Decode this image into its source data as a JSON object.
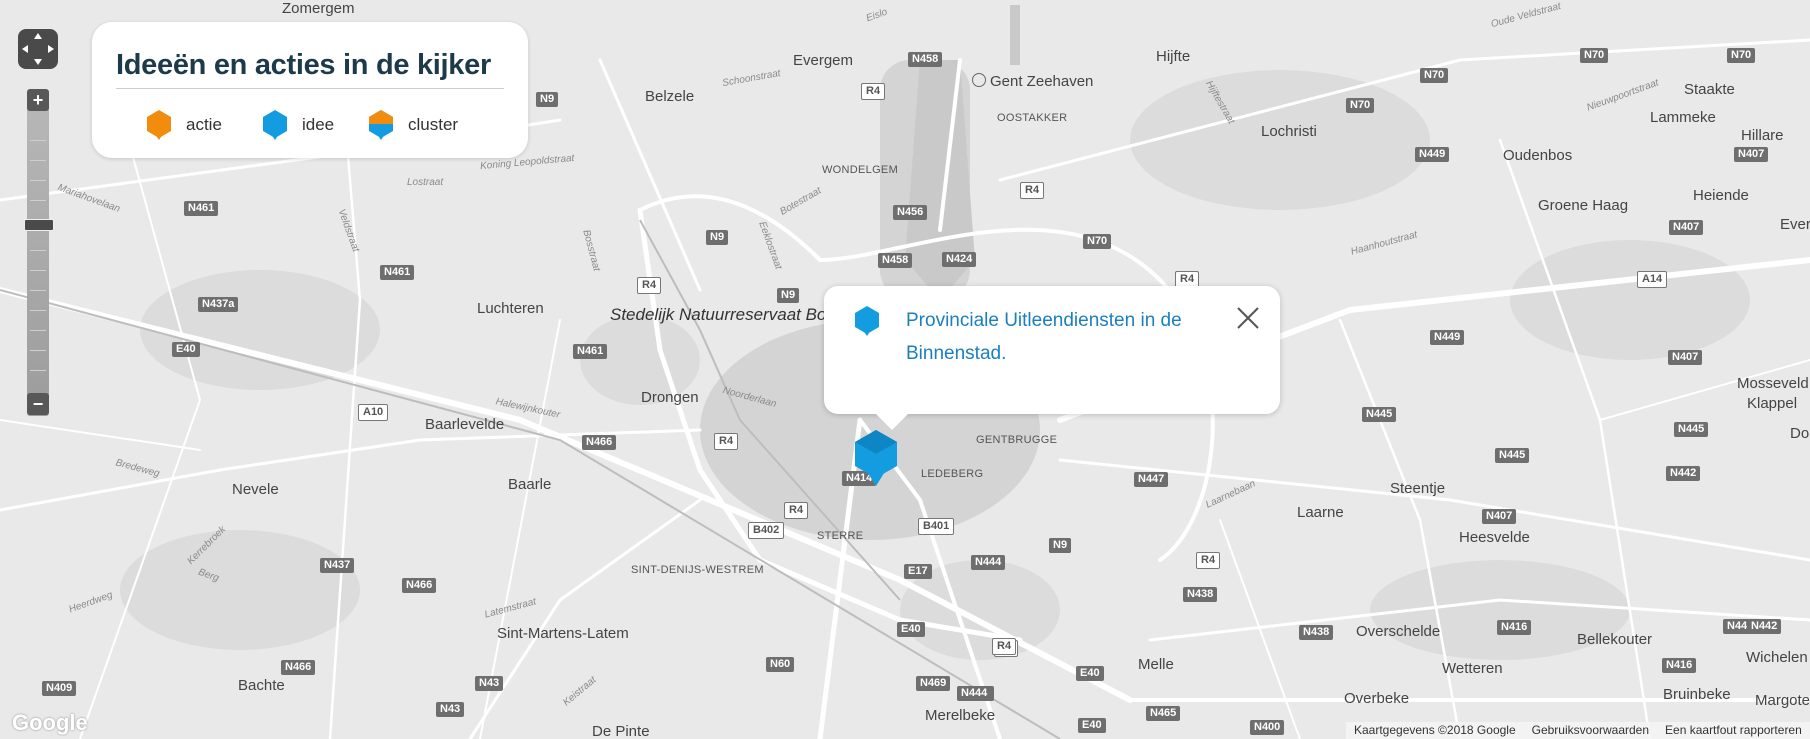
{
  "legend": {
    "title": "Ideeën en acties in de kijker",
    "items": [
      {
        "label": "actie",
        "icon": "hexagon-orange-icon",
        "color": "#f28c0f"
      },
      {
        "label": "idee",
        "icon": "hexagon-blue-icon",
        "color": "#139de0"
      },
      {
        "label": "cluster",
        "icon": "hexagon-split-icon",
        "color_top": "#f28c0f",
        "color_bottom": "#139de0"
      }
    ]
  },
  "popup": {
    "title": "Provinciale Uitleendiensten in de Binnenstad.",
    "icon": "hexagon-blue-icon",
    "close_icon": "close-icon"
  },
  "controls": {
    "zoom_in": "+",
    "zoom_out": "−"
  },
  "map": {
    "places": {
      "zomergem": "Zomergem",
      "evergem": "Evergem",
      "belzele": "Belzele",
      "gent_zeehaven": "Gent Zeehaven",
      "hijfte": "Hijfte",
      "lochristi": "Lochristi",
      "staakte": "Staakte",
      "lammeke": "Lammeke",
      "hillare": "Hillare",
      "oudenbos": "Oudenbos",
      "heiende": "Heiende",
      "groene_haag": "Groene Haag",
      "ever": "Ever",
      "oostakker": "OOSTAKKER",
      "wondelgem": "WONDELGEM",
      "luchteren": "Luchteren",
      "stedelijk": "Stedelijk Natuurreservaat Bourgoyen-Ossemeersen",
      "drongen": "Drongen",
      "baarlevelde": "Baarlevelde",
      "gentbrugge": "GENTBRUGGE",
      "ledeberg": "LEDEBERG",
      "sterre": "STERRE",
      "nevele": "Nevele",
      "baarle": "Baarle",
      "sint_denijs": "SINT-DENIJS-WESTREM",
      "sint_martens": "Sint-Martens-Latem",
      "bachte": "Bachte",
      "de_pinte": "De Pinte",
      "merelbeke": "Merelbeke",
      "melle": "Melle",
      "laarne": "Laarne",
      "steentje": "Steentje",
      "heesvelde": "Heesvelde",
      "overschelde": "Overschelde",
      "wetteren": "Wetteren",
      "overbeke": "Overbeke",
      "bellekouter": "Bellekouter",
      "wichelen": "Wichelen",
      "bruinbeke": "Bruinbeke",
      "margote": "Margote",
      "mosseveld": "Mosseveld",
      "klappel": "Klappel",
      "do": "Do"
    },
    "streets": {
      "eisio": "Eislo",
      "schoonstraat": "Schoonstraat",
      "leopoldstraat": "Koning Leopoldstraat",
      "lostraat": "Lostraat",
      "mariahovelaan": "Mariahovelaan",
      "botestraat": "Botestraat",
      "bosstraat": "Bosstraat",
      "eeklostraat": "Eeklostraat",
      "veldstraat": "Veldstraat",
      "hijftestraat": "Hijftestraat",
      "haanhoutstraat": "Haanhoutstraat",
      "nieuwpoortstraat": "Nieuwpoortstraat",
      "halewijnkouter": "Halewijnkouter",
      "noorderlaan": "Noorderlaan",
      "bredeweg": "Bredeweg",
      "kerrebroek": "Kerrebroek",
      "berg": "Berg",
      "heerdweg": "Heerdweg",
      "latemstraat": "Latemstraat",
      "keistraat": "Keistraat",
      "laarnebaan": "Laarnebaan",
      "oude_veldstraat": "Oude Veldstraat"
    },
    "roads": [
      "N458",
      "R4",
      "N9",
      "N70",
      "N461",
      "N437a",
      "E40",
      "A10",
      "N466",
      "N456",
      "N424",
      "N449",
      "N407",
      "A14",
      "N445",
      "N442",
      "N447",
      "B402",
      "B401",
      "E17",
      "N444",
      "N438",
      "N416",
      "N437",
      "N43",
      "N409",
      "N60",
      "N469",
      "N465",
      "N400",
      "N414"
    ]
  },
  "attribution": {
    "google_logo": "Google",
    "data": "Kaartgegevens ©2018 Google",
    "terms": "Gebruiksvoorwaarden",
    "report": "Een kaartfout rapporteren"
  }
}
